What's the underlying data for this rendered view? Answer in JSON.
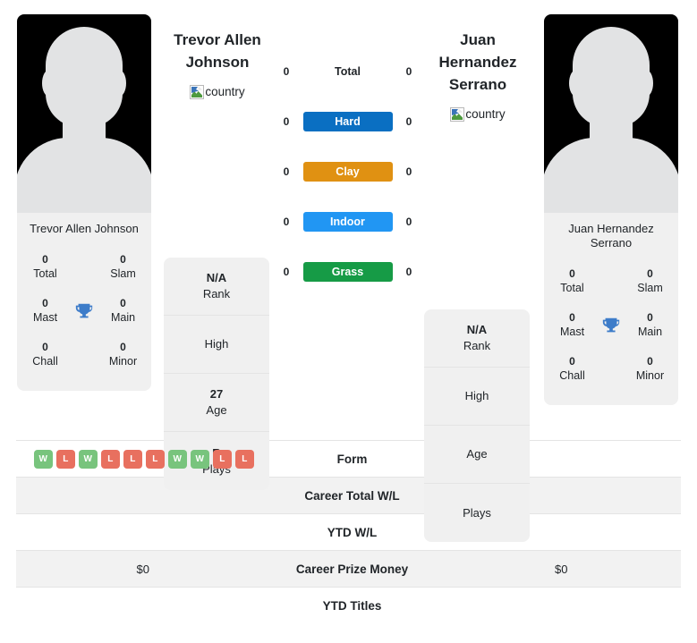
{
  "players": {
    "left": {
      "name": "Trevor Allen Johnson",
      "card_name": "Trevor Allen Johnson",
      "country_alt": "country",
      "titles": [
        {
          "value": "0",
          "label": "Total"
        },
        {
          "value": "0",
          "label": "Slam"
        },
        {
          "value": "0",
          "label": "Mast"
        },
        {
          "value": "0",
          "label": "Main"
        },
        {
          "value": "0",
          "label": "Chall"
        },
        {
          "value": "0",
          "label": "Minor"
        }
      ],
      "info": [
        {
          "value": "N/A",
          "label": "Rank"
        },
        {
          "value": "",
          "label": "High"
        },
        {
          "value": "27",
          "label": "Age"
        },
        {
          "value": "R",
          "label": "Plays"
        }
      ],
      "surface_counts": {
        "total": "0",
        "hard": "0",
        "clay": "0",
        "indoor": "0",
        "grass": "0"
      },
      "form": [
        "W",
        "L",
        "W",
        "L",
        "L",
        "L",
        "W",
        "W",
        "L",
        "L"
      ],
      "career_total_wl": "",
      "ytd_wl": "",
      "career_prize_money": "$0",
      "ytd_titles": ""
    },
    "right": {
      "name": "Juan Hernandez Serrano",
      "card_name": "Juan Hernandez Serrano",
      "country_alt": "country",
      "titles": [
        {
          "value": "0",
          "label": "Total"
        },
        {
          "value": "0",
          "label": "Slam"
        },
        {
          "value": "0",
          "label": "Mast"
        },
        {
          "value": "0",
          "label": "Main"
        },
        {
          "value": "0",
          "label": "Chall"
        },
        {
          "value": "0",
          "label": "Minor"
        }
      ],
      "info": [
        {
          "value": "N/A",
          "label": "Rank"
        },
        {
          "value": "",
          "label": "High"
        },
        {
          "value": "",
          "label": "Age"
        },
        {
          "value": "",
          "label": "Plays"
        }
      ],
      "surface_counts": {
        "total": "0",
        "hard": "0",
        "clay": "0",
        "indoor": "0",
        "grass": "0"
      },
      "form": [],
      "career_total_wl": "",
      "ytd_wl": "",
      "career_prize_money": "$0",
      "ytd_titles": ""
    }
  },
  "surfaces": [
    {
      "key": "total",
      "label": "Total",
      "styled": false,
      "color": ""
    },
    {
      "key": "hard",
      "label": "Hard",
      "styled": true,
      "color": "#0a6fc2"
    },
    {
      "key": "clay",
      "label": "Clay",
      "styled": true,
      "color": "#e09112"
    },
    {
      "key": "indoor",
      "label": "Indoor",
      "styled": true,
      "color": "#2196f3"
    },
    {
      "key": "grass",
      "label": "Grass",
      "styled": true,
      "color": "#169b46"
    }
  ],
  "bottom_table": {
    "rows": [
      {
        "label": "Form",
        "shaded": false,
        "type": "form"
      },
      {
        "label": "Career Total W/L",
        "shaded": true,
        "type": "text",
        "left": "",
        "right": ""
      },
      {
        "label": "YTD W/L",
        "shaded": false,
        "type": "text",
        "left": "",
        "right": ""
      },
      {
        "label": "Career Prize Money",
        "shaded": true,
        "type": "text",
        "left": "$0",
        "right": "$0"
      },
      {
        "label": "YTD Titles",
        "shaded": false,
        "type": "text",
        "left": "",
        "right": ""
      }
    ]
  },
  "colors": {
    "panel_bg": "#f0f0f0",
    "row_shade": "#f2f2f2",
    "trophy": "#3d7cc9",
    "form_win": "#78c47d",
    "form_loss": "#e8705f",
    "text": "#212529"
  },
  "icons": {
    "trophy": "trophy-icon",
    "broken_image": "broken-image-icon"
  }
}
